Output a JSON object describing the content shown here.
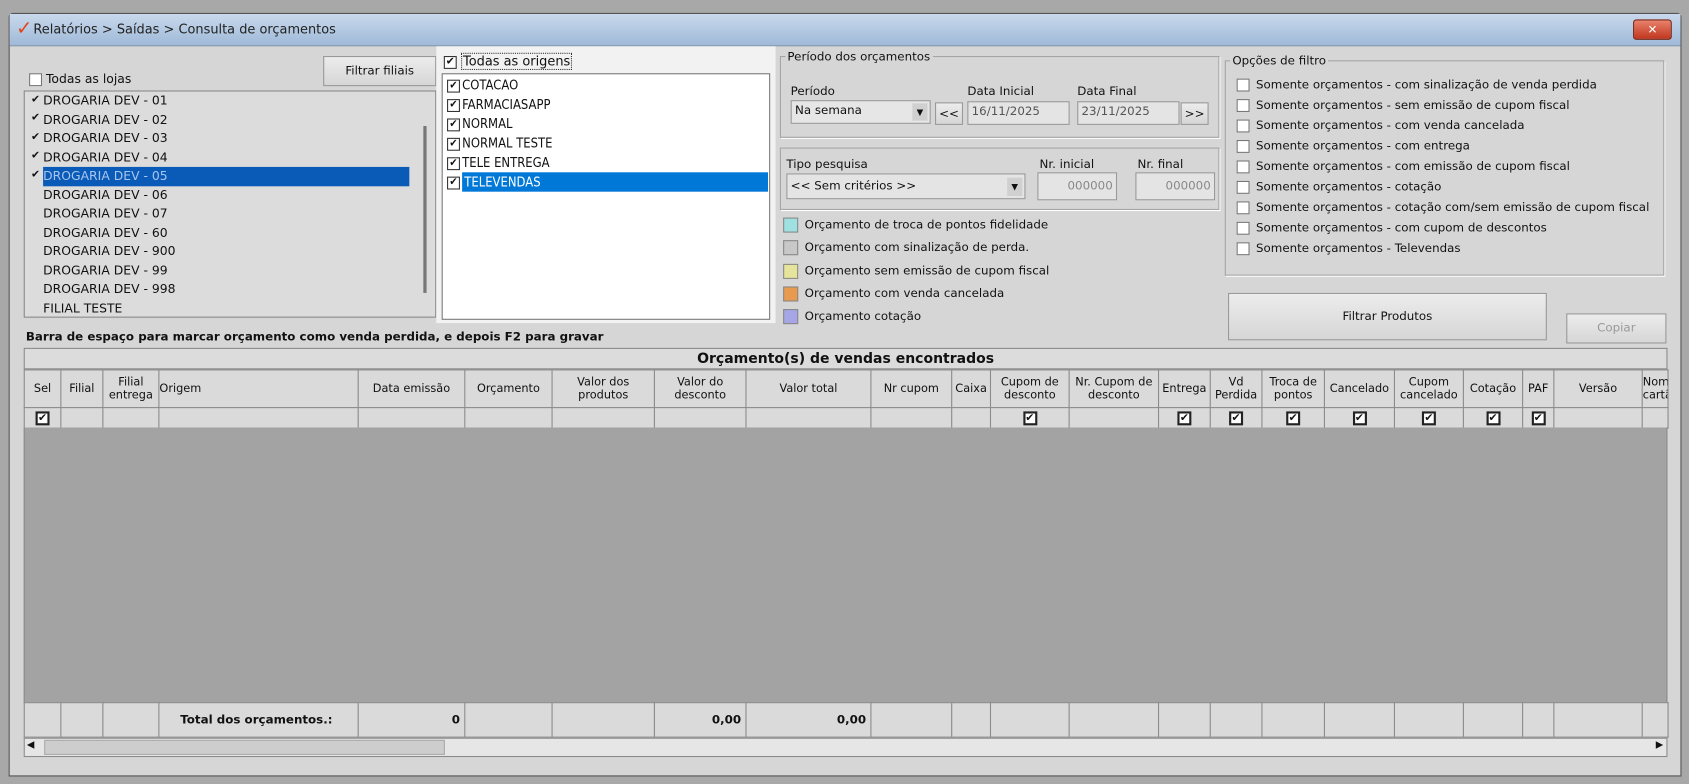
{
  "window": {
    "title": "Relatórios > Saídas > Consulta de orçamentos",
    "close": "✕"
  },
  "stores": {
    "all_label": "Todas as lojas",
    "all_checked": false,
    "filter_button": "Filtrar filiais",
    "items": [
      {
        "name": "DROGARIA DEV - 01",
        "checked": true
      },
      {
        "name": "DROGARIA DEV - 02",
        "checked": true
      },
      {
        "name": "DROGARIA DEV - 03",
        "checked": true
      },
      {
        "name": "DROGARIA DEV - 04",
        "checked": true
      },
      {
        "name": "DROGARIA DEV - 05",
        "checked": true,
        "selected": true
      },
      {
        "name": "DROGARIA DEV - 06",
        "checked": false
      },
      {
        "name": "DROGARIA DEV - 07",
        "checked": false
      },
      {
        "name": "DROGARIA DEV - 60",
        "checked": false
      },
      {
        "name": "DROGARIA DEV - 900",
        "checked": false
      },
      {
        "name": "DROGARIA DEV - 99",
        "checked": false
      },
      {
        "name": "DROGARIA DEV - 998",
        "checked": false
      },
      {
        "name": "FILIAL TESTE",
        "checked": false
      }
    ]
  },
  "origins": {
    "all_label": "Todas as origens",
    "all_checked": true,
    "items": [
      {
        "name": "COTACAO",
        "checked": true
      },
      {
        "name": "FARMACIASAPP",
        "checked": true
      },
      {
        "name": "NORMAL",
        "checked": true
      },
      {
        "name": "NORMAL TESTE",
        "checked": true
      },
      {
        "name": "TELE ENTREGA",
        "checked": true
      },
      {
        "name": "TELEVENDAS",
        "checked": true,
        "selected": true
      }
    ]
  },
  "period": {
    "legend": "Período dos orçamentos",
    "period_label": "Período",
    "period_value": "Na semana",
    "start_label": "Data Inicial",
    "start_value": "16/11/2025",
    "end_label": "Data Final",
    "end_value": "23/11/2025",
    "prev": "<<",
    "next": ">>"
  },
  "search": {
    "type_label": "Tipo pesquisa",
    "type_value": "<< Sem critérios >>",
    "nr_start_label": "Nr. inicial",
    "nr_start_value": "000000",
    "nr_end_label": "Nr. final",
    "nr_end_value": "000000"
  },
  "legend_items": [
    {
      "label": "Orçamento de troca de pontos fidelidade",
      "color": "#9fe0e0"
    },
    {
      "label": "Orçamento com sinalização de perda.",
      "color": "#c8c8c8"
    },
    {
      "label": "Orçamento sem emissão de cupom fiscal",
      "color": "#e6e49a"
    },
    {
      "label": "Orçamento com venda cancelada",
      "color": "#e89a4e"
    },
    {
      "label": "Orçamento cotação",
      "color": "#a6a6e6"
    }
  ],
  "filter_options": {
    "legend": "Opções de filtro",
    "items": [
      "Somente orçamentos - com sinalização de venda perdida",
      "Somente orçamentos - sem emissão de cupom fiscal",
      "Somente orçamentos - com venda cancelada",
      "Somente orçamentos - com entrega",
      "Somente orçamentos - com emissão de cupom fiscal",
      "Somente orçamentos - cotação",
      "Somente orçamentos - cotação com/sem emissão de cupom fiscal",
      "Somente orçamentos - com cupom de descontos",
      "Somente orçamentos - Televendas"
    ]
  },
  "buttons": {
    "filter_products": "Filtrar Produtos",
    "copy": "Copiar"
  },
  "hint": "Barra de espaço para marcar orçamento como venda perdida, e depois F2 para gravar",
  "grid": {
    "title": "Orçamento(s) de vendas encontrados",
    "columns": [
      "Sel",
      "Filial",
      "Filial entrega",
      "Origem",
      "Data emissão",
      "Orçamento",
      "Valor dos produtos",
      "Valor do desconto",
      "Valor total",
      "Nr cupom",
      "Caixa",
      "Cupom de desconto",
      "Nr. Cupom de desconto",
      "Entrega",
      "Vd Perdida",
      "Troca de pontos",
      "Cancelado",
      "Cupom cancelado",
      "Cotação",
      "PAF",
      "Versão",
      "Nome cartão"
    ],
    "filter_checked": [
      0,
      11,
      13,
      14,
      15,
      16,
      17,
      18,
      19
    ],
    "footer": {
      "label": "Total dos orçamentos.:",
      "count": "0",
      "discount": "0,00",
      "total": "0,00"
    }
  }
}
